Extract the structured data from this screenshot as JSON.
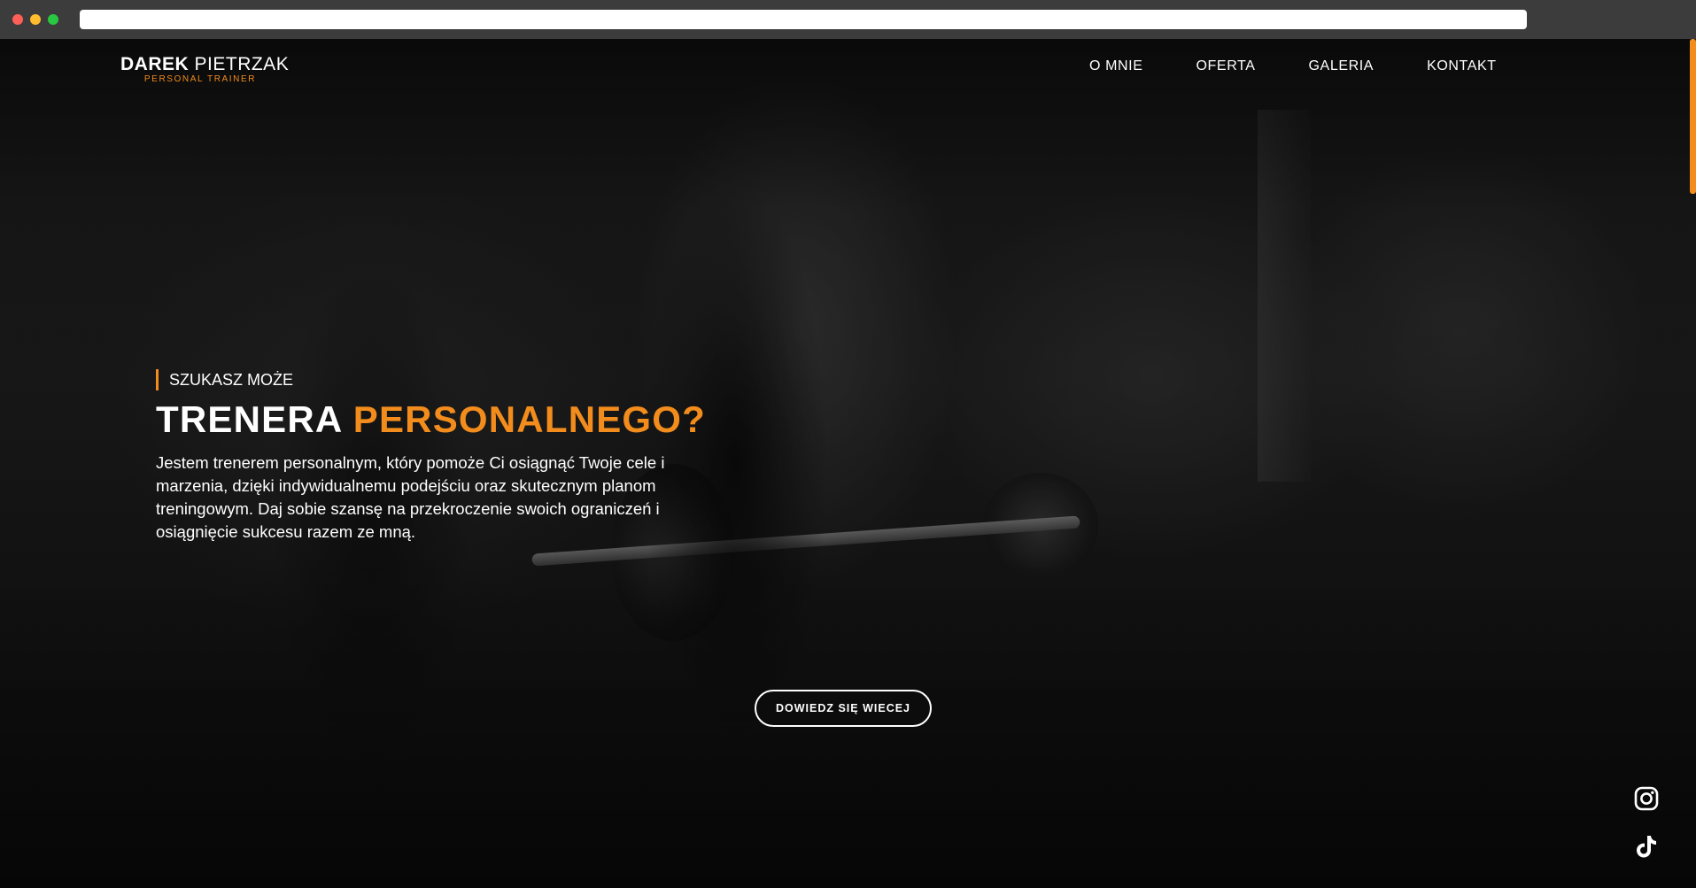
{
  "header": {
    "logo": {
      "first_name": "DAREK",
      "last_name": "PIETRZAK",
      "subtitle": "PERSONAL TRAINER"
    },
    "nav": [
      {
        "label": "O MNIE"
      },
      {
        "label": "OFERTA"
      },
      {
        "label": "GALERIA"
      },
      {
        "label": "KONTAKT"
      }
    ]
  },
  "hero": {
    "eyebrow": "SZUKASZ MOŻE",
    "headline_part1": "TRENERA",
    "headline_part2": "PERSONALNEGO?",
    "lead": "Jestem trenerem personalnym, który pomoże Ci osiągnąć Twoje cele i marzenia, dzięki indywidualnemu podejściu oraz skutecznym planom treningowym. Daj sobie szansę na przekroczenie swoich ograniczeń i osiągnięcie sukcesu razem ze mną.",
    "cta_label": "DOWIEDZ SIĘ WIECEJ"
  },
  "social": [
    {
      "icon": "instagram-icon"
    },
    {
      "icon": "tiktok-icon"
    }
  ],
  "colors": {
    "accent": "#f28c1c",
    "text": "#ffffff",
    "background": "#0d0d0d"
  }
}
